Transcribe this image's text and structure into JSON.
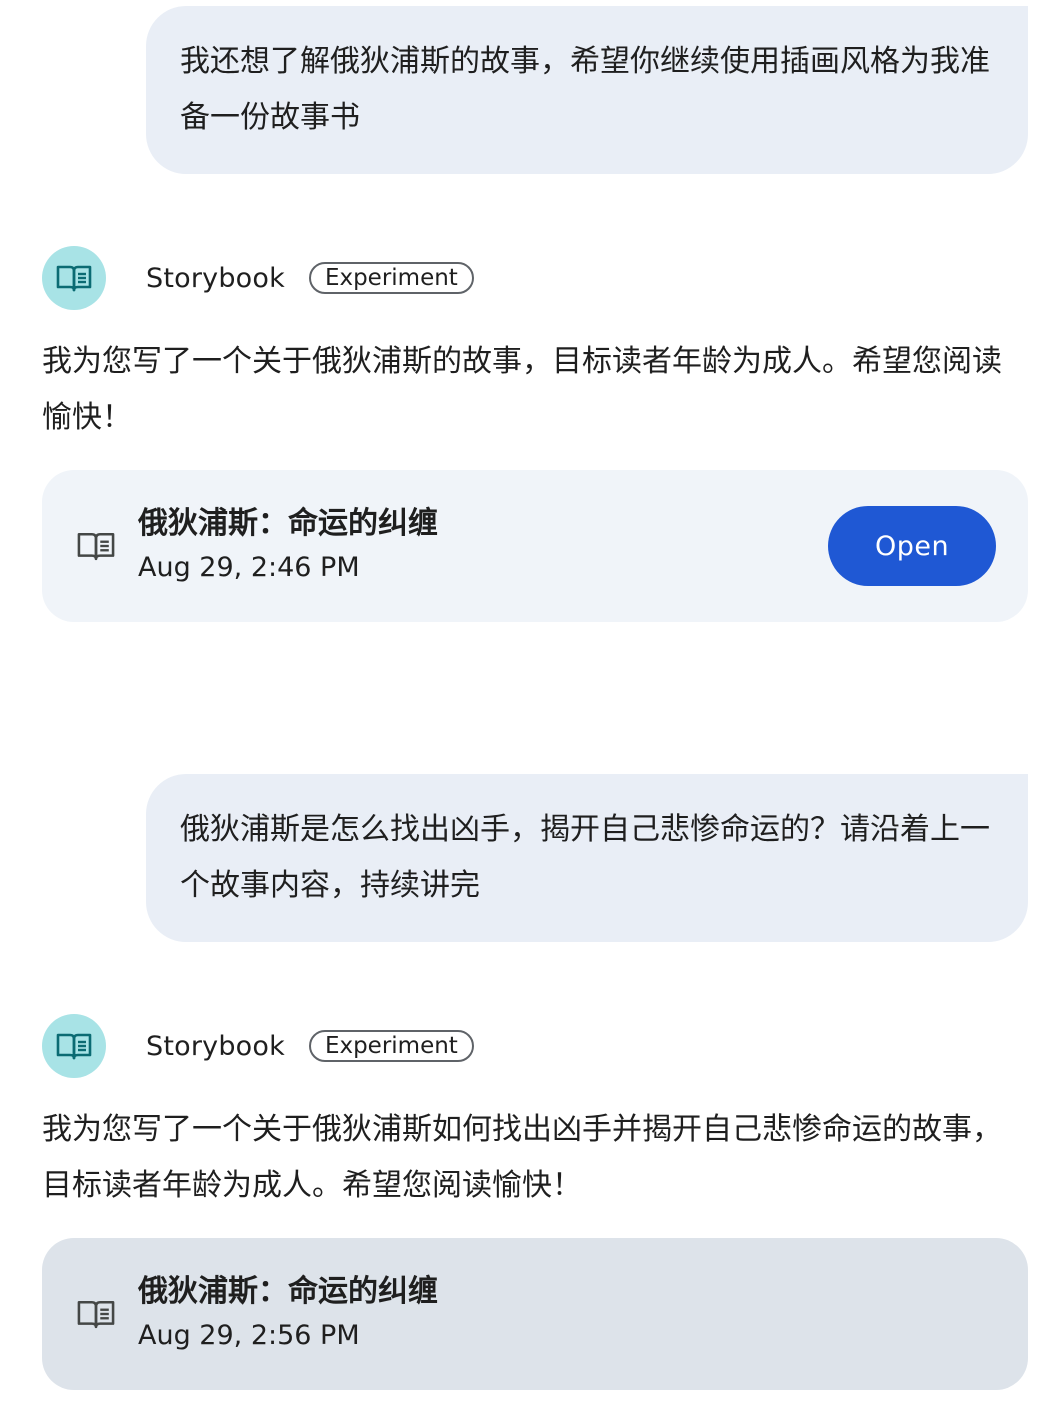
{
  "conversation": {
    "user_message_1": "我还想了解俄狄浦斯的故事，希望你继续使用插画风格为我准备一份故事书",
    "bot_1": {
      "name": "Storybook",
      "badge": "Experiment",
      "text": "我为您写了一个关于俄狄浦斯的故事，目标读者年龄为成人。希望您阅读愉快！",
      "card": {
        "title": "俄狄浦斯：命运的纠缠",
        "date": "Aug 29, 2:46 PM",
        "button": "Open"
      }
    },
    "user_message_2": "俄狄浦斯是怎么找出凶手，揭开自己悲惨命运的？请沿着上一个故事内容，持续讲完",
    "bot_2": {
      "name": "Storybook",
      "badge": "Experiment",
      "text": "我为您写了一个关于俄狄浦斯如何找出凶手并揭开自己悲惨命运的故事，目标读者年龄为成人。希望您阅读愉快！",
      "card": {
        "title": "俄狄浦斯：命运的纠缠",
        "date": "Aug 29, 2:56 PM"
      }
    }
  },
  "icons": {
    "avatar_icon": "book-open-icon",
    "card_icon": "book-open-icon"
  },
  "colors": {
    "user_bubble": "#e9eef6",
    "avatar_bg": "#a8e3e6",
    "avatar_icon": "#0b6b73",
    "card_bg": "#f0f4f9",
    "card_selected_bg": "#dde3ea",
    "open_button": "#1f58d4"
  }
}
